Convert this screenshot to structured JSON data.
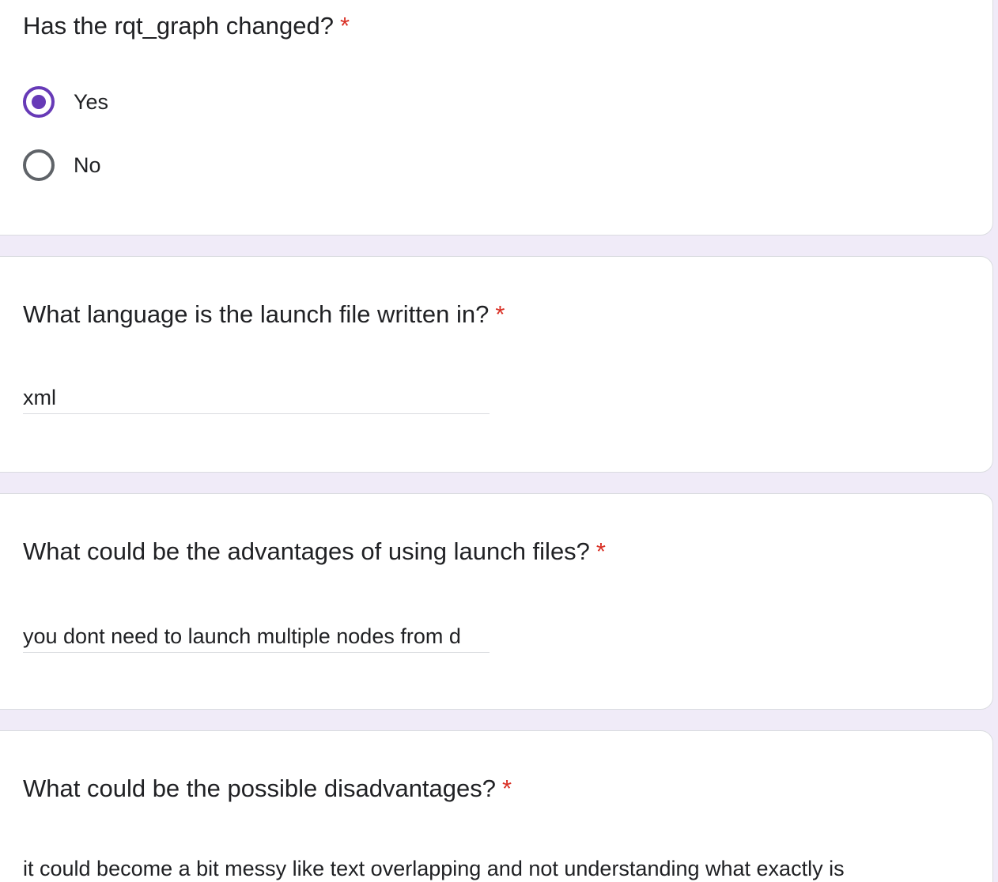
{
  "required_marker": "*",
  "accent_color": "#673ab7",
  "required_color": "#d93025",
  "q1": {
    "title": "Has the rqt_graph changed?",
    "options": [
      {
        "label": "Yes",
        "selected": true
      },
      {
        "label": "No",
        "selected": false
      }
    ]
  },
  "q2": {
    "title": "What language is the launch file written in?",
    "answer": "xml"
  },
  "q3": {
    "title": "What could be the advantages of using launch files?",
    "answer": "you dont need to launch multiple nodes from d"
  },
  "q4": {
    "title": "What could be the possible disadvantages?",
    "answer": "it could become a bit messy like text overlapping and not understanding what exactly is"
  }
}
